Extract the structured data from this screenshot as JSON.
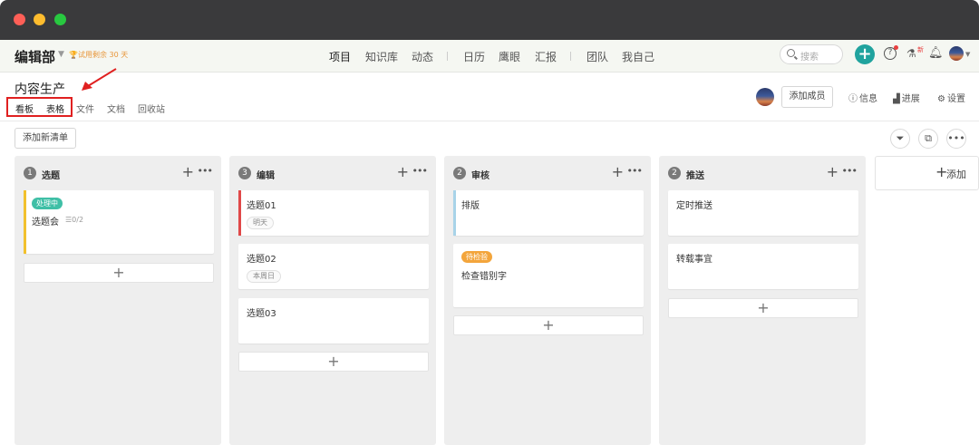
{
  "navbar": {
    "org_name": "编辑部",
    "trial_text": "试用剩余 30 天",
    "items": [
      "项目",
      "知识库",
      "动态",
      "日历",
      "鹰眼",
      "汇报",
      "团队",
      "我自己"
    ],
    "search_placeholder": "搜索",
    "new_badge": "新"
  },
  "project": {
    "title": "内容生产",
    "view_tabs": [
      "看板",
      "表格",
      "文件",
      "文档",
      "回收站"
    ],
    "add_member_label": "添加成员",
    "links": [
      "信息",
      "进展",
      "设置"
    ]
  },
  "toolbar": {
    "add_list_label": "添加新清单"
  },
  "columns": [
    {
      "count": "1",
      "title": "选题",
      "cards": [
        {
          "status": "处理中",
          "title": "选题会",
          "subtasks": "0/2",
          "bar_color": "#f2c12e"
        }
      ]
    },
    {
      "count": "3",
      "title": "编辑",
      "cards": [
        {
          "title": "选题01",
          "due": "明天",
          "bar_color": "#e04848"
        },
        {
          "title": "选题02",
          "due": "本周日"
        },
        {
          "title": "选题03"
        }
      ]
    },
    {
      "count": "2",
      "title": "审核",
      "cards": [
        {
          "title": "排版",
          "bar_color": "#a8d3e8"
        },
        {
          "status": "待检验",
          "title": "检查错别字"
        }
      ]
    },
    {
      "count": "2",
      "title": "推送",
      "cards": [
        {
          "title": "定时推送"
        },
        {
          "title": "转载事宜"
        }
      ]
    }
  ],
  "add_column_label": "添加",
  "colors": {
    "accent": "#20a39e",
    "status_processing": "#3fbfa6",
    "status_pending": "#f3a53c",
    "highlight": "#e02020"
  }
}
